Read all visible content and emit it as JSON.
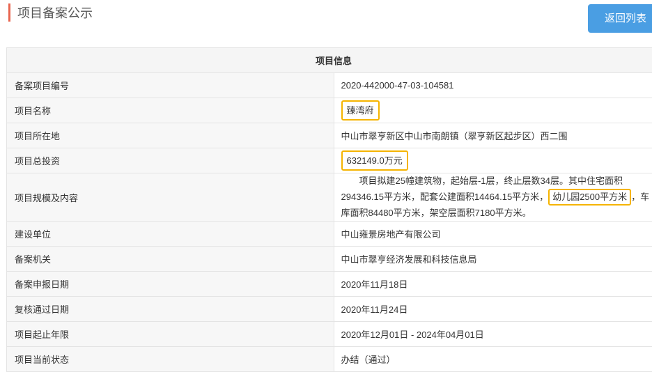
{
  "header": {
    "title": "项目备案公示",
    "back_label": "返回列表"
  },
  "table": {
    "caption": "项目信息",
    "rows": [
      {
        "label": "备案项目编号",
        "value": "2020-442000-47-03-104581"
      },
      {
        "label": "项目名称",
        "value": "臻湾府"
      },
      {
        "label": "项目所在地",
        "value": "中山市翠亨新区中山市南朗镇（翠亨新区起步区）西二围"
      },
      {
        "label": "项目总投资",
        "value": "632149.0万元"
      },
      {
        "label": "项目规模及内容",
        "value_part1": "项目拟建25幢建筑物，起始层-1层，终止层数34层。其中住宅面积294346.15平方米，配套公建面积14464.15平方米，",
        "value_highlight": "幼儿园2500平方米",
        "value_part2": "，车库面积84480平方米，架空层面积7180平方米。"
      },
      {
        "label": "建设单位",
        "value": "中山雍景房地产有限公司"
      },
      {
        "label": "备案机关",
        "value": "中山市翠亨经济发展和科技信息局"
      },
      {
        "label": "备案申报日期",
        "value": "2020年11月18日"
      },
      {
        "label": "复核通过日期",
        "value": "2020年11月24日"
      },
      {
        "label": "项目起止年限",
        "value": "2020年12月01日 - 2024年04月01日"
      },
      {
        "label": "项目当前状态",
        "value": "办结（通过）"
      }
    ]
  },
  "colors": {
    "accent_bar": "#e8654f",
    "button": "#4a9ee3",
    "highlight_border": "#f5b400"
  }
}
